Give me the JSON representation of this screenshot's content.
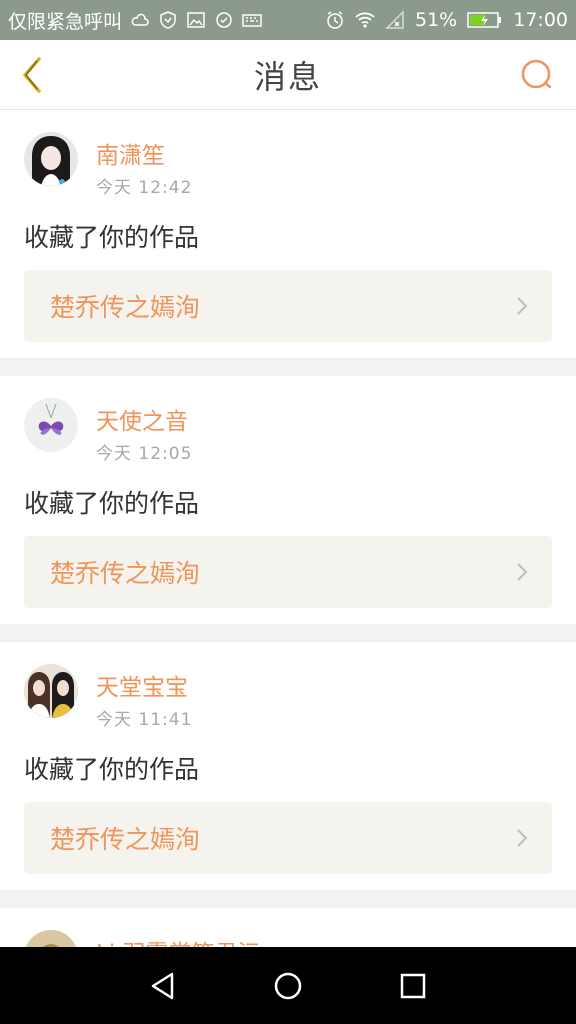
{
  "status_bar": {
    "left_text": "仅限紧急呼叫",
    "battery_text": "51%",
    "time": "17:00",
    "icons": [
      "cloud-icon",
      "shield-icon",
      "image-icon",
      "sync-icon",
      "keyboard-icon",
      "alarm-icon",
      "wifi-icon",
      "signal-icon",
      "battery-icon"
    ]
  },
  "header": {
    "title": "消息",
    "back_icon": "chevron-left-icon",
    "search_icon": "search-icon"
  },
  "messages": [
    {
      "sender": "南潇笙",
      "time": "今天 12:42",
      "text": "收藏了你的作品",
      "work": "楚乔传之嫣洵"
    },
    {
      "sender": "天使之音",
      "time": "今天 12:05",
      "text": "收藏了你的作品",
      "work": "楚乔传之嫣洵"
    },
    {
      "sender": "天堂宝宝",
      "time": "今天 11:41",
      "text": "收藏了你的作品",
      "work": "楚乔传之嫣洵"
    }
  ],
  "partial_message": {
    "sender": "Li 羽霓裳笛君沅"
  },
  "colors": {
    "accent": "#f0945a",
    "status_bar": "#8c9a8c",
    "card_bg": "#f4f3ee",
    "separator": "#f2f2f2"
  },
  "nav_bar": {
    "icons": [
      "back-triangle-icon",
      "home-circle-icon",
      "recents-square-icon"
    ]
  }
}
